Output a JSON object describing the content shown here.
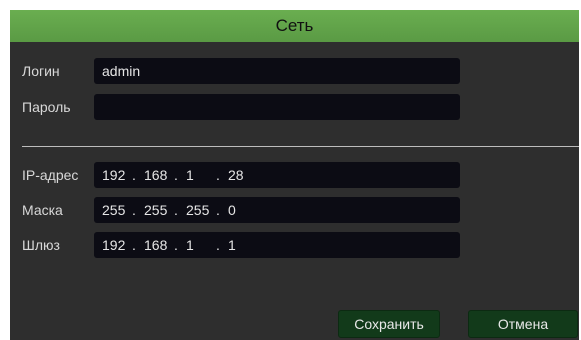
{
  "dialog": {
    "title": "Сеть"
  },
  "auth": {
    "login_label": "Логин",
    "login_value": "admin",
    "password_label": "Пароль",
    "password_value": ""
  },
  "network": {
    "ip_label": "IP-адрес",
    "ip": [
      "192",
      "168",
      "1",
      "28"
    ],
    "mask_label": "Маска",
    "mask": [
      "255",
      "255",
      "255",
      "0"
    ],
    "gateway_label": "Шлюз",
    "gateway": [
      "192",
      "168",
      "1",
      "1"
    ]
  },
  "buttons": {
    "save": "Сохранить",
    "cancel": "Отмена"
  },
  "colors": {
    "title_bar": "#5fa349",
    "panel": "#2e2e2e",
    "field": "#0c0c14",
    "button": "#123a1a"
  }
}
